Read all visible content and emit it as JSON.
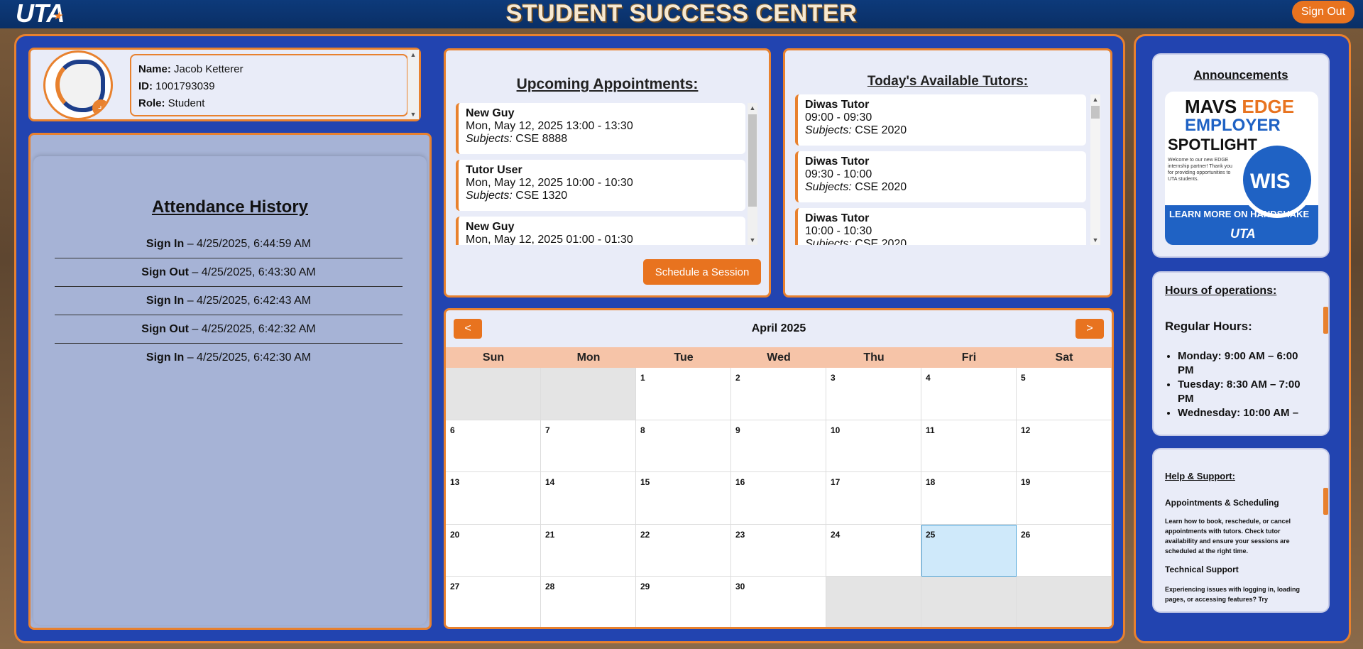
{
  "header": {
    "logo": "UTA",
    "title": "STUDENT SUCCESS CENTER",
    "signout_label": "Sign Out"
  },
  "profile": {
    "name_label": "Name:",
    "name": "Jacob Ketterer",
    "id_label": "ID:",
    "id": "1001793039",
    "role_label": "Role:",
    "role": "Student"
  },
  "attendance": {
    "title": "Attendance History",
    "rows": [
      {
        "action": "Sign In",
        "time": "– 4/25/2025, 6:44:59 AM"
      },
      {
        "action": "Sign Out",
        "time": "– 4/25/2025, 6:43:30 AM"
      },
      {
        "action": "Sign In",
        "time": "– 4/25/2025, 6:42:43 AM"
      },
      {
        "action": "Sign Out",
        "time": "– 4/25/2025, 6:42:32 AM"
      },
      {
        "action": "Sign In",
        "time": "– 4/25/2025, 6:42:30 AM"
      }
    ]
  },
  "appointments": {
    "title": "Upcoming Appointments:",
    "subjects_label": "Subjects:",
    "items": [
      {
        "name": "New Guy",
        "when": "Mon, May 12, 2025 13:00 - 13:30",
        "subjects": "CSE 8888"
      },
      {
        "name": "Tutor User",
        "when": "Mon, May 12, 2025 10:00 - 10:30",
        "subjects": "CSE 1320"
      },
      {
        "name": "New Guy",
        "when": "Mon, May 12, 2025 01:00 - 01:30",
        "subjects": ""
      }
    ],
    "schedule_label": "Schedule a Session"
  },
  "tutors": {
    "title": "Today's Available Tutors:",
    "subjects_label": "Subjects:",
    "items": [
      {
        "name": "Diwas Tutor",
        "time": "09:00 - 09:30",
        "subjects": "CSE 2020"
      },
      {
        "name": "Diwas Tutor",
        "time": "09:30 - 10:00",
        "subjects": "CSE 2020"
      },
      {
        "name": "Diwas Tutor",
        "time": "10:00 - 10:30",
        "subjects": "CSE 2020"
      }
    ]
  },
  "calendar": {
    "month": "April 2025",
    "prev": "<",
    "next": ">",
    "weekdays": [
      "Sun",
      "Mon",
      "Tue",
      "Wed",
      "Thu",
      "Fri",
      "Sat"
    ],
    "cells": [
      "",
      "",
      "1",
      "2",
      "3",
      "4",
      "5",
      "6",
      "7",
      "8",
      "9",
      "10",
      "11",
      "12",
      "13",
      "14",
      "15",
      "16",
      "17",
      "18",
      "19",
      "20",
      "21",
      "22",
      "23",
      "24",
      "25",
      "26",
      "27",
      "28",
      "29",
      "30",
      "",
      "",
      ""
    ],
    "today": "25"
  },
  "announcements": {
    "title": "Announcements",
    "image": {
      "line1a": "MAVS ",
      "line1b": "EDGE",
      "line2": "EMPLOYER",
      "line3": "SPOTLIGHT",
      "small": "Welcome to our new EDGE internship partner! Thank you for providing opportunities to UTA students.",
      "badge": "WIS",
      "handshake": "LEARN MORE ON HANDSHAKE",
      "footer": "UTA"
    }
  },
  "hours": {
    "title": "Hours of operations:",
    "subtitle": "Regular Hours:",
    "items": [
      "Monday: 9:00 AM – 6:00 PM",
      "Tuesday: 8:30 AM – 7:00 PM",
      "Wednesday: 10:00 AM –"
    ]
  },
  "help": {
    "title": "Help & Support:",
    "sub1": "Appointments & Scheduling",
    "p1": "Learn how to book, reschedule, or cancel appointments with tutors. Check tutor availability and ensure your sessions are scheduled at the right time.",
    "sub2": "Technical Support",
    "p2": "Experiencing issues with logging in, loading pages, or accessing features? Try"
  },
  "colors": {
    "accent": "#e8731f",
    "frame": "#2244b0",
    "header": "#0d3a7a",
    "today": "#cfe9fa"
  }
}
